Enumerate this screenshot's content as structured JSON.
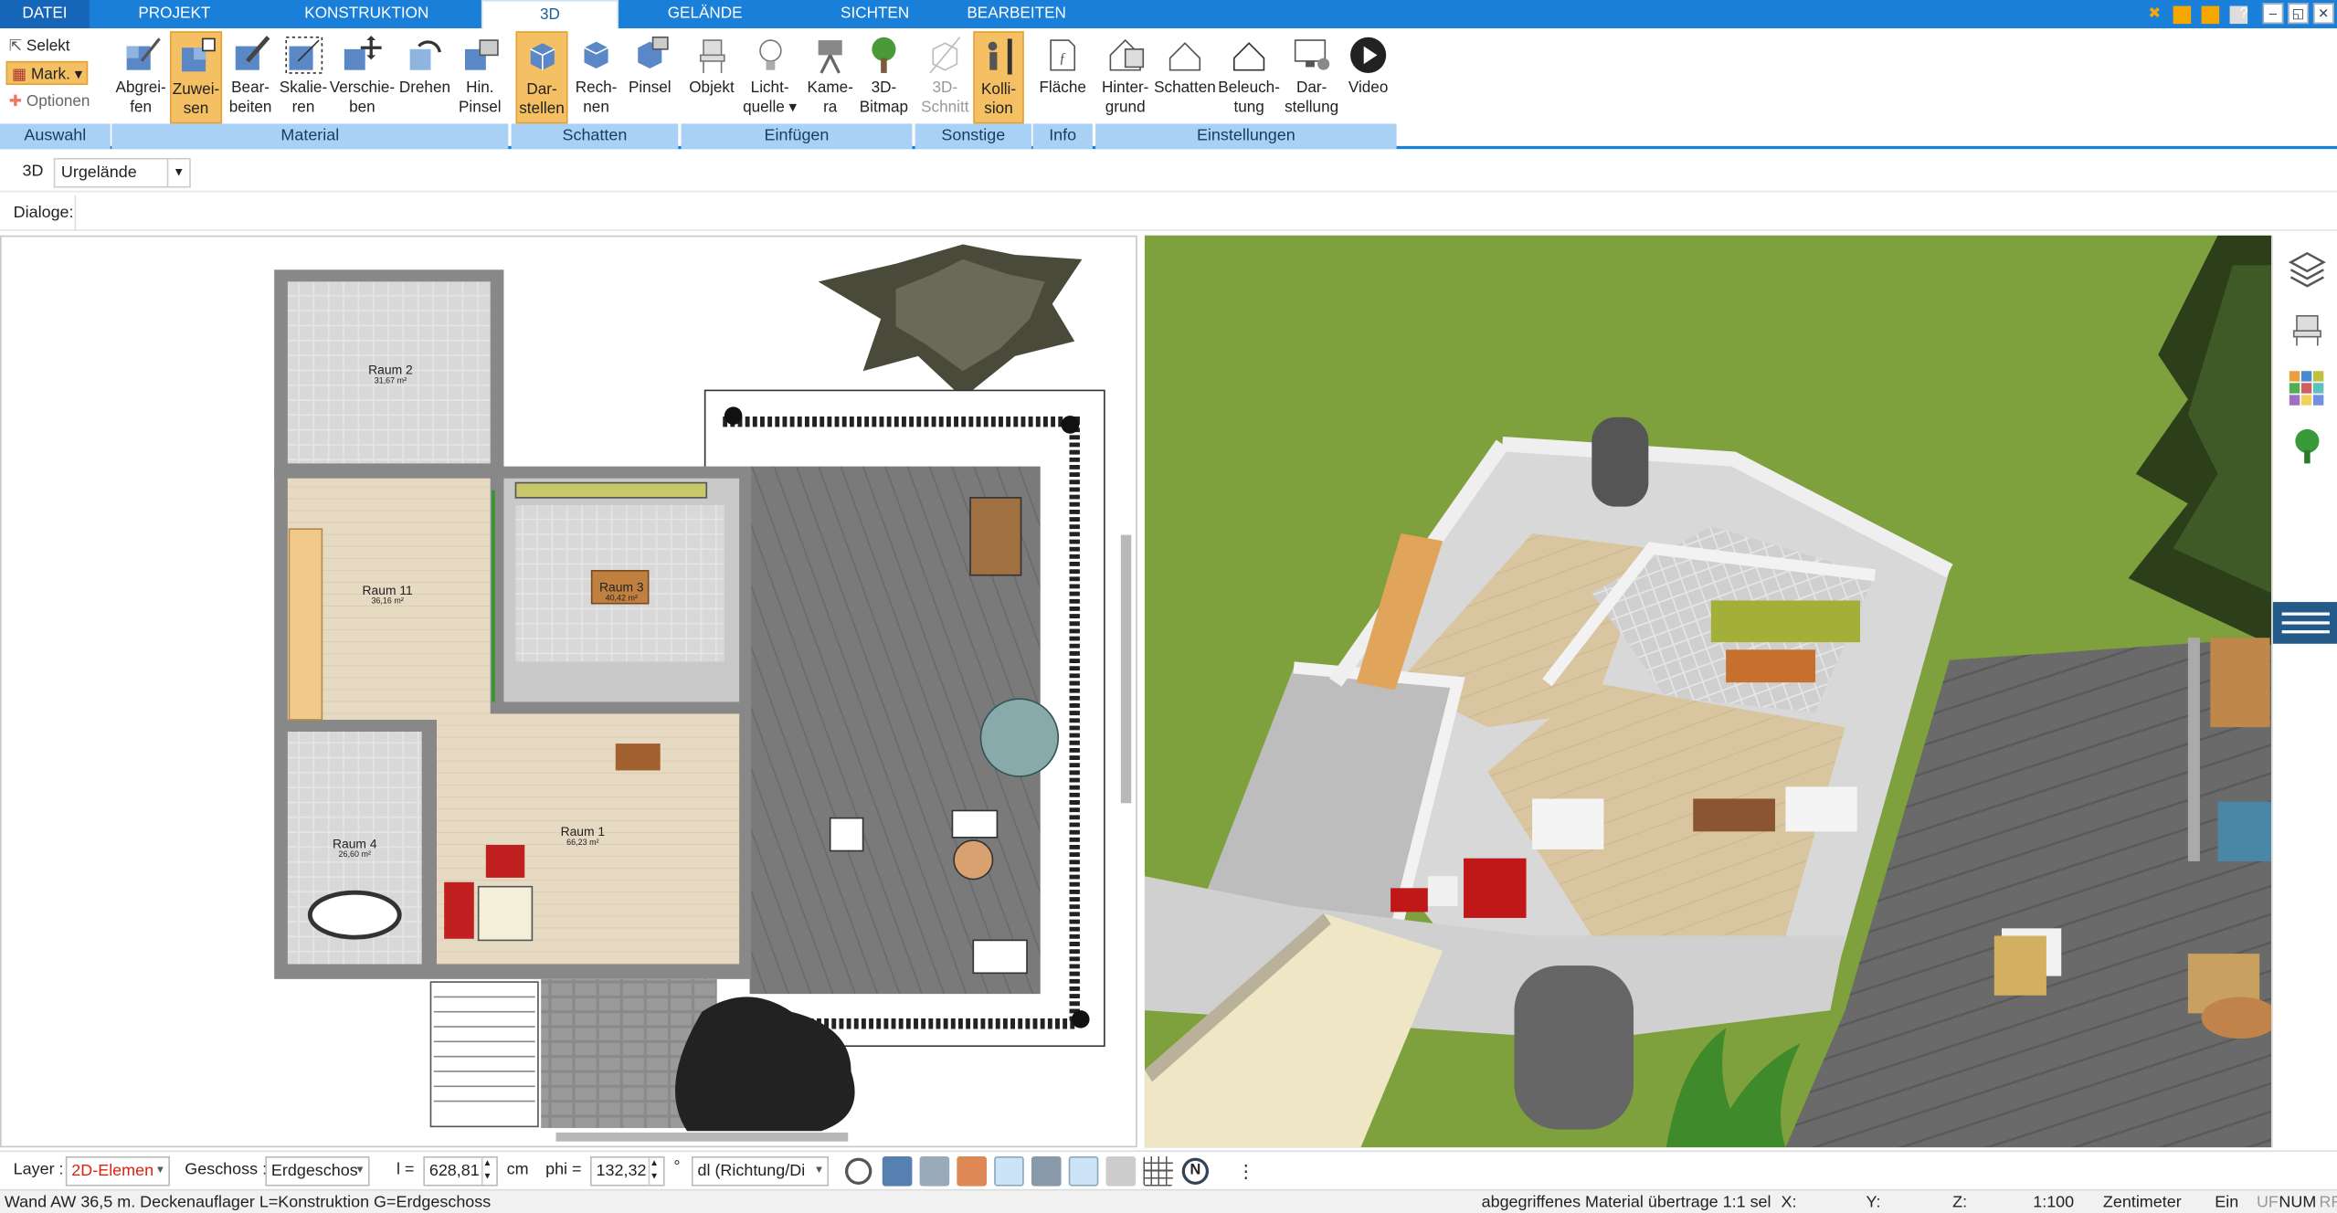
{
  "menu": {
    "tabs": [
      {
        "label": "DATEI"
      },
      {
        "label": "PROJEKT"
      },
      {
        "label": "KONSTRUKTION"
      },
      {
        "label": "3D"
      },
      {
        "label": "GELÄNDE"
      },
      {
        "label": "SICHTEN"
      },
      {
        "label": "BEARBEITEN"
      }
    ],
    "active_tab": "3D"
  },
  "ribbon": {
    "auswahl": {
      "selekt": "Selekt",
      "mark": "Mark.",
      "optionen": "Optionen",
      "group": "Auswahl"
    },
    "material": {
      "group": "Material",
      "buttons": [
        {
          "line1": "Abgrei-",
          "line2": "fen"
        },
        {
          "line1": "Zuwei-",
          "line2": "sen"
        },
        {
          "line1": "Bear-",
          "line2": "beiten"
        },
        {
          "line1": "Skalie-",
          "line2": "ren"
        },
        {
          "line1": "Verschie-",
          "line2": "ben"
        },
        {
          "line1": "Drehen",
          "line2": ""
        },
        {
          "line1": "Hin.",
          "line2": "Pinsel"
        }
      ]
    },
    "schatten": {
      "group": "Schatten",
      "buttons": [
        {
          "line1": "Dar-",
          "line2": "stellen"
        },
        {
          "line1": "Rech-",
          "line2": "nen"
        },
        {
          "line1": "Pinsel",
          "line2": ""
        }
      ]
    },
    "einfuegen": {
      "group": "Einfügen",
      "buttons": [
        {
          "line1": "Objekt",
          "line2": ""
        },
        {
          "line1": "Licht-",
          "line2": "quelle ▾"
        },
        {
          "line1": "Kame-",
          "line2": "ra"
        },
        {
          "line1": "3D-",
          "line2": "Bitmap"
        }
      ]
    },
    "sonstige": {
      "group": "Sonstige",
      "buttons": [
        {
          "line1": "3D-",
          "line2": "Schnitt"
        },
        {
          "line1": "Kolli-",
          "line2": "sion"
        }
      ]
    },
    "info": {
      "group": "Info",
      "buttons": [
        {
          "line1": "Fläche",
          "line2": ""
        }
      ]
    },
    "einstellungen": {
      "group": "Einstellungen",
      "buttons": [
        {
          "line1": "Hinter-",
          "line2": "grund"
        },
        {
          "line1": "Schatten",
          "line2": ""
        },
        {
          "line1": "Beleuch-",
          "line2": "tung"
        },
        {
          "line1": "Dar-",
          "line2": "stellung"
        },
        {
          "line1": "Video",
          "line2": ""
        }
      ]
    }
  },
  "toolbar": {
    "mode_label": "3D",
    "terrain_value": "Urgelände"
  },
  "dialoge": {
    "label": "Dialoge:"
  },
  "plan": {
    "rooms": [
      {
        "name": "Raum 2",
        "area": "31,67 m²"
      },
      {
        "name": "Raum 11",
        "area": "36,16 m²"
      },
      {
        "name": "Raum 3",
        "area": "40,42 m²"
      },
      {
        "name": "Raum 1",
        "area": "66,23 m²"
      },
      {
        "name": "Raum 4",
        "area": "26,60 m²"
      }
    ]
  },
  "bottom": {
    "layer_label": "Layer :",
    "layer_value": "2D-Elemen",
    "geschoss_label": "Geschoss :",
    "geschoss_value": "Erdgeschos",
    "l_label": "l =",
    "l_value": "628,81",
    "l_unit": "cm",
    "phi_label": "phi =",
    "phi_value": "132,32",
    "phi_unit": "°",
    "dl_value": "dl (Richtung/Di"
  },
  "status": {
    "left": "Wand AW 36,5 m. Deckenauflager L=Konstruktion G=Erdgeschoss",
    "message": "abgegriffenes Material übertrage 1:1 sel",
    "x": "X:",
    "y": "Y:",
    "z": "Z:",
    "scale": "1:100",
    "unit": "Zentimeter",
    "ein": "Ein",
    "uf": "UF",
    "num": "NUM",
    "rf": "RF"
  },
  "colors": {
    "accent": "#1a7fd8",
    "ribbon_group": "#a9d0f5",
    "selected": "#f5c063",
    "grass": "#789f3a",
    "deck": "#6c6c6c"
  }
}
